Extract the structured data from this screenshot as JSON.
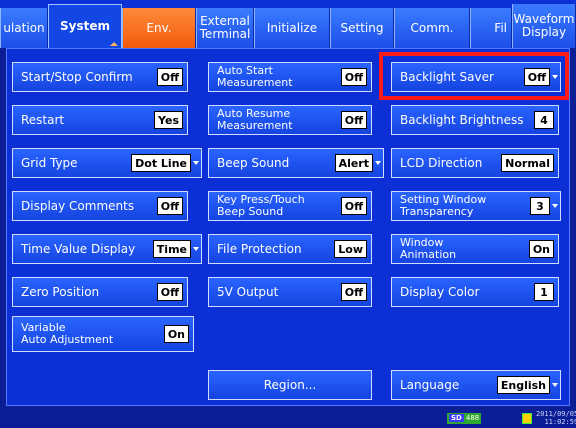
{
  "tabs": [
    {
      "label": "ulation",
      "state": "inactive"
    },
    {
      "label": "System",
      "state": "active"
    },
    {
      "label": "Env.",
      "state": "inactive"
    },
    {
      "label": "External\nTerminal",
      "state": "inactive"
    },
    {
      "label": "Initialize",
      "state": "inactive"
    },
    {
      "label": "Setting",
      "state": "inactive"
    },
    {
      "label": "Comm.",
      "state": "inactive"
    },
    {
      "label": "Fil",
      "state": "inactive"
    },
    {
      "label": "Waveform\nDisplay",
      "state": "inactive"
    }
  ],
  "col1": [
    {
      "label": "Start/Stop Confirm",
      "value": "Off"
    },
    {
      "label": "Restart",
      "value": "Yes"
    },
    {
      "label": "Grid Type",
      "value": "Dot Line"
    },
    {
      "label": "Display Comments",
      "value": "Off"
    },
    {
      "label": "Time Value Display",
      "value": "Time"
    },
    {
      "label": "Zero Position",
      "value": "Off"
    },
    {
      "label": "Variable\nAuto Adjustment",
      "value": "On"
    }
  ],
  "col2": [
    {
      "label": "Auto Start\nMeasurement",
      "value": "Off"
    },
    {
      "label": "Auto Resume\nMeasurement",
      "value": "Off"
    },
    {
      "label": "Beep Sound",
      "value": "Alert"
    },
    {
      "label": "Key Press/Touch\nBeep Sound",
      "value": "Off"
    },
    {
      "label": "File Protection",
      "value": "Low"
    },
    {
      "label": "5V Output",
      "value": "Off"
    }
  ],
  "col3": [
    {
      "label": "Backlight Saver",
      "value": "Off"
    },
    {
      "label": "Backlight Brightness",
      "value": "4"
    },
    {
      "label": "LCD Direction",
      "value": "Normal"
    },
    {
      "label": "Setting Window\nTransparency",
      "value": "3"
    },
    {
      "label": "Window\nAnimation",
      "value": "On"
    },
    {
      "label": "Display Color",
      "value": "1"
    }
  ],
  "region_button": "Region...",
  "language": {
    "label": "Language",
    "value": "English"
  },
  "status": {
    "sd_label": "SD",
    "sd_value": "488",
    "date": "2011/09/05",
    "time": "11:02:59"
  },
  "colors": {
    "highlight": "#ff1a1a",
    "background": "#0b1e96",
    "button": "#1e54f2"
  }
}
